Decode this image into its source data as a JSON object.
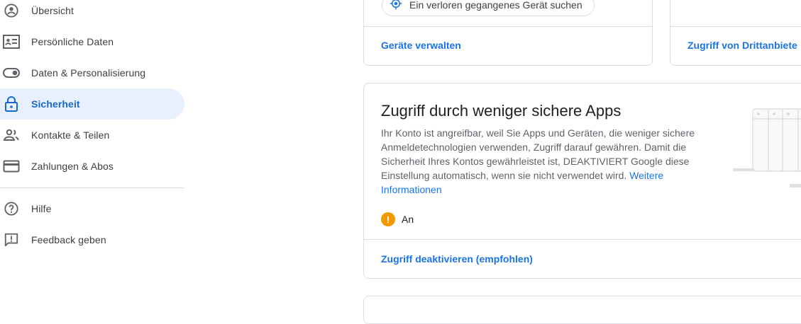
{
  "sidebar": {
    "items": [
      {
        "label": "Übersicht",
        "icon": "account-circle-icon"
      },
      {
        "label": "Persönliche Daten",
        "icon": "id-card-icon"
      },
      {
        "label": "Daten & Personalisierung",
        "icon": "toggle-icon"
      },
      {
        "label": "Sicherheit",
        "icon": "lock-icon",
        "active": true
      },
      {
        "label": "Kontakte & Teilen",
        "icon": "people-icon"
      },
      {
        "label": "Zahlungen & Abos",
        "icon": "credit-card-icon"
      }
    ],
    "secondary": [
      {
        "label": "Hilfe",
        "icon": "help-icon"
      },
      {
        "label": "Feedback geben",
        "icon": "feedback-icon"
      }
    ]
  },
  "devices_card": {
    "chip_label": "Ein verloren gegangenes Gerät suchen",
    "link": "Geräte verwalten"
  },
  "thirdparty_card": {
    "link": "Zugriff von Drittanbiete"
  },
  "less_secure_card": {
    "title": "Zugriff durch weniger sichere Apps",
    "description": "Ihr Konto ist angreifbar, weil Sie Apps und Geräten, die weniger sichere Anmeldetechnologien verwenden, Zugriff darauf gewähren. Damit die Sicherheit Ihres Kontos gewährleistet ist, DEAKTIVIERT Google diese Einstellung automatisch, wenn sie nicht verwendet wird.",
    "learn_more": "Weitere Informationen",
    "status": "An",
    "action": "Zugriff deaktivieren (empfohlen)"
  },
  "colors": {
    "accent": "#1a73e8",
    "active_bg": "#e8f0fe",
    "warning": "#f29900"
  }
}
